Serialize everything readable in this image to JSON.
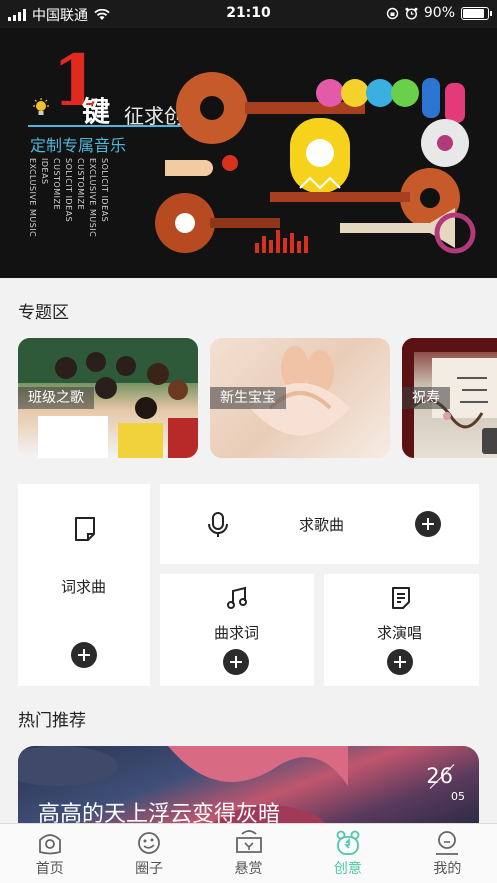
{
  "status_bar": {
    "carrier": "中国联通",
    "time": "21:10",
    "battery": "90%",
    "battery_level": 0.9
  },
  "banner": {
    "big_digit": "1",
    "title_a": "键",
    "title_b": "征求创意",
    "subtitle": "定制专属音乐",
    "vertical_texts": [
      "EXCLUSIVE MUSIC",
      "IDEAS",
      "CUSTOMIZE",
      "SOLICIT IDEAS",
      "CUSTOMIZE",
      "EXCLUSIVE MUSIC",
      "SOLICIT IDEAS"
    ]
  },
  "topic_section": {
    "title": "专题区",
    "cards": [
      {
        "label": "班级之歌"
      },
      {
        "label": "新生宝宝"
      },
      {
        "label": "祝寿"
      }
    ]
  },
  "grid": {
    "lyrics_request": "词求曲",
    "song_request": "求歌曲",
    "music_request": "曲求词",
    "sing_request": "求演唱"
  },
  "hot_section": {
    "title": "热门推荐",
    "card": {
      "song_title": "高高的天上浮云变得灰暗",
      "day": "26",
      "month": "05"
    }
  },
  "tabbar": {
    "tabs": [
      {
        "label": "首页",
        "icon": "home-icon"
      },
      {
        "label": "圈子",
        "icon": "circle-icon"
      },
      {
        "label": "悬赏",
        "icon": "reward-icon"
      },
      {
        "label": "创意",
        "icon": "idea-icon",
        "active": true
      },
      {
        "label": "我的",
        "icon": "profile-icon"
      }
    ]
  },
  "colors": {
    "accent": "#4cc9a6",
    "banner_red": "#e12a1f",
    "banner_blue": "#4fb6d9"
  }
}
